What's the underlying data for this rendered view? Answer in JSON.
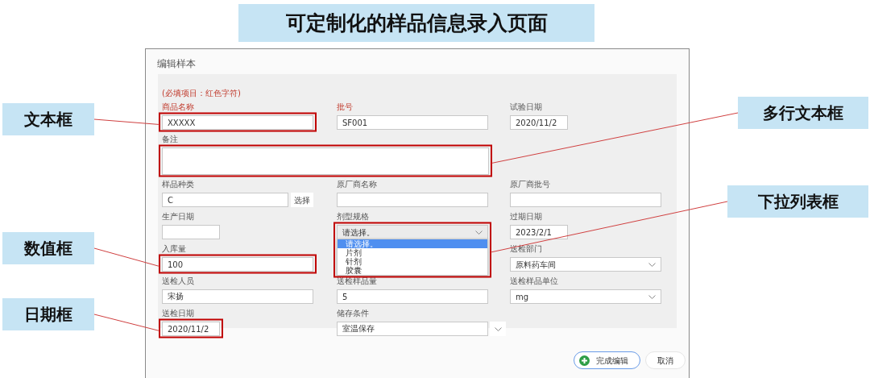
{
  "banner": {
    "title": "可定制化的样品信息录入页面"
  },
  "window": {
    "title": "编辑样本",
    "required_note": "(必填项目：红色字符)"
  },
  "fields": [
    {
      "label": "商品名称",
      "required": true,
      "kind": "text",
      "value": "XXXXX"
    },
    {
      "label": "批号",
      "required": true,
      "kind": "text",
      "value": "SF001"
    },
    {
      "label": "试验日期",
      "required": false,
      "kind": "date",
      "value": "2020/11/2"
    },
    {
      "label": "备注",
      "required": false,
      "kind": "textarea"
    },
    {
      "label": "样品种类",
      "required": false,
      "kind": "picker",
      "value": "C",
      "button": "选择"
    },
    {
      "label": "原厂商名称",
      "required": false,
      "kind": "text"
    },
    {
      "label": "原厂商批号",
      "required": false,
      "kind": "text"
    },
    {
      "label": "生产日期",
      "required": false,
      "kind": "date"
    },
    {
      "label": "剂型规格",
      "required": false,
      "kind": "select",
      "value": "请选择。",
      "expanded": true,
      "options": [
        {
          "label": "请选择。",
          "selected": true
        },
        {
          "label": "片剂",
          "selected": false
        },
        {
          "label": "针剂",
          "selected": false
        },
        {
          "label": "胶囊",
          "selected": false
        }
      ]
    },
    {
      "label": "过期日期",
      "required": false,
      "kind": "date",
      "value": "2023/2/1"
    },
    {
      "label": "入库量",
      "required": false,
      "kind": "number",
      "value": "100"
    },
    {
      "label": "送检部门",
      "required": false,
      "kind": "select",
      "value": "原料药车间",
      "expanded": false
    },
    {
      "label": "送检人员",
      "required": false,
      "kind": "text",
      "value": "宋扬"
    },
    {
      "label": "送检样品量",
      "required": false,
      "kind": "number",
      "value": "5"
    },
    {
      "label": "送检样品单位",
      "required": false,
      "kind": "select",
      "value": "mg",
      "expanded": false
    },
    {
      "label": "送检日期",
      "required": false,
      "kind": "date",
      "value": "2020/11/2"
    },
    {
      "label": "储存条件",
      "required": false,
      "kind": "combo",
      "value": "室温保存"
    }
  ],
  "buttons": [
    {
      "label": "完成编辑",
      "kind": "primary"
    },
    {
      "label": "取消",
      "kind": "secondary"
    }
  ],
  "annotations": [
    {
      "text": "文本框"
    },
    {
      "text": "多行文本框"
    },
    {
      "text": "下拉列表框"
    },
    {
      "text": "数值框"
    },
    {
      "text": "日期框"
    }
  ]
}
